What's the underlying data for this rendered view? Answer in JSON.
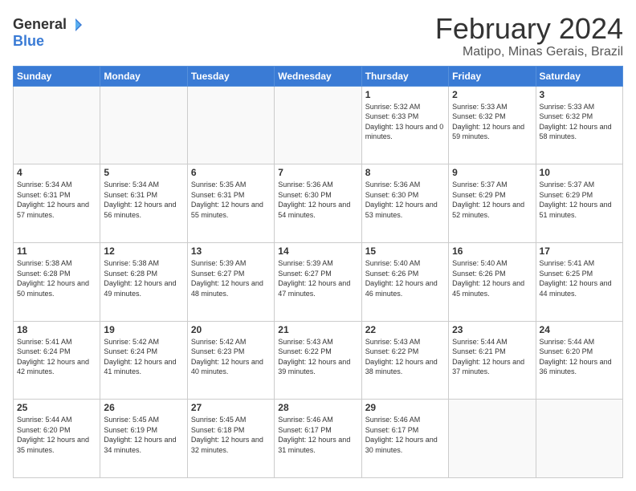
{
  "header": {
    "logo": {
      "general": "General",
      "blue": "Blue"
    },
    "title": "February 2024",
    "location": "Matipo, Minas Gerais, Brazil"
  },
  "weekdays": [
    "Sunday",
    "Monday",
    "Tuesday",
    "Wednesday",
    "Thursday",
    "Friday",
    "Saturday"
  ],
  "weeks": [
    [
      {
        "day": "",
        "sunrise": "",
        "sunset": "",
        "daylight": "",
        "empty": true
      },
      {
        "day": "",
        "sunrise": "",
        "sunset": "",
        "daylight": "",
        "empty": true
      },
      {
        "day": "",
        "sunrise": "",
        "sunset": "",
        "daylight": "",
        "empty": true
      },
      {
        "day": "",
        "sunrise": "",
        "sunset": "",
        "daylight": "",
        "empty": true
      },
      {
        "day": "1",
        "sunrise": "5:32 AM",
        "sunset": "6:33 PM",
        "daylight": "13 hours and 0 minutes."
      },
      {
        "day": "2",
        "sunrise": "5:33 AM",
        "sunset": "6:32 PM",
        "daylight": "12 hours and 59 minutes."
      },
      {
        "day": "3",
        "sunrise": "5:33 AM",
        "sunset": "6:32 PM",
        "daylight": "12 hours and 58 minutes."
      }
    ],
    [
      {
        "day": "4",
        "sunrise": "5:34 AM",
        "sunset": "6:31 PM",
        "daylight": "12 hours and 57 minutes."
      },
      {
        "day": "5",
        "sunrise": "5:34 AM",
        "sunset": "6:31 PM",
        "daylight": "12 hours and 56 minutes."
      },
      {
        "day": "6",
        "sunrise": "5:35 AM",
        "sunset": "6:31 PM",
        "daylight": "12 hours and 55 minutes."
      },
      {
        "day": "7",
        "sunrise": "5:36 AM",
        "sunset": "6:30 PM",
        "daylight": "12 hours and 54 minutes."
      },
      {
        "day": "8",
        "sunrise": "5:36 AM",
        "sunset": "6:30 PM",
        "daylight": "12 hours and 53 minutes."
      },
      {
        "day": "9",
        "sunrise": "5:37 AM",
        "sunset": "6:29 PM",
        "daylight": "12 hours and 52 minutes."
      },
      {
        "day": "10",
        "sunrise": "5:37 AM",
        "sunset": "6:29 PM",
        "daylight": "12 hours and 51 minutes."
      }
    ],
    [
      {
        "day": "11",
        "sunrise": "5:38 AM",
        "sunset": "6:28 PM",
        "daylight": "12 hours and 50 minutes."
      },
      {
        "day": "12",
        "sunrise": "5:38 AM",
        "sunset": "6:28 PM",
        "daylight": "12 hours and 49 minutes."
      },
      {
        "day": "13",
        "sunrise": "5:39 AM",
        "sunset": "6:27 PM",
        "daylight": "12 hours and 48 minutes."
      },
      {
        "day": "14",
        "sunrise": "5:39 AM",
        "sunset": "6:27 PM",
        "daylight": "12 hours and 47 minutes."
      },
      {
        "day": "15",
        "sunrise": "5:40 AM",
        "sunset": "6:26 PM",
        "daylight": "12 hours and 46 minutes."
      },
      {
        "day": "16",
        "sunrise": "5:40 AM",
        "sunset": "6:26 PM",
        "daylight": "12 hours and 45 minutes."
      },
      {
        "day": "17",
        "sunrise": "5:41 AM",
        "sunset": "6:25 PM",
        "daylight": "12 hours and 44 minutes."
      }
    ],
    [
      {
        "day": "18",
        "sunrise": "5:41 AM",
        "sunset": "6:24 PM",
        "daylight": "12 hours and 42 minutes."
      },
      {
        "day": "19",
        "sunrise": "5:42 AM",
        "sunset": "6:24 PM",
        "daylight": "12 hours and 41 minutes."
      },
      {
        "day": "20",
        "sunrise": "5:42 AM",
        "sunset": "6:23 PM",
        "daylight": "12 hours and 40 minutes."
      },
      {
        "day": "21",
        "sunrise": "5:43 AM",
        "sunset": "6:22 PM",
        "daylight": "12 hours and 39 minutes."
      },
      {
        "day": "22",
        "sunrise": "5:43 AM",
        "sunset": "6:22 PM",
        "daylight": "12 hours and 38 minutes."
      },
      {
        "day": "23",
        "sunrise": "5:44 AM",
        "sunset": "6:21 PM",
        "daylight": "12 hours and 37 minutes."
      },
      {
        "day": "24",
        "sunrise": "5:44 AM",
        "sunset": "6:20 PM",
        "daylight": "12 hours and 36 minutes."
      }
    ],
    [
      {
        "day": "25",
        "sunrise": "5:44 AM",
        "sunset": "6:20 PM",
        "daylight": "12 hours and 35 minutes."
      },
      {
        "day": "26",
        "sunrise": "5:45 AM",
        "sunset": "6:19 PM",
        "daylight": "12 hours and 34 minutes."
      },
      {
        "day": "27",
        "sunrise": "5:45 AM",
        "sunset": "6:18 PM",
        "daylight": "12 hours and 32 minutes."
      },
      {
        "day": "28",
        "sunrise": "5:46 AM",
        "sunset": "6:17 PM",
        "daylight": "12 hours and 31 minutes."
      },
      {
        "day": "29",
        "sunrise": "5:46 AM",
        "sunset": "6:17 PM",
        "daylight": "12 hours and 30 minutes."
      },
      {
        "day": "",
        "sunrise": "",
        "sunset": "",
        "daylight": "",
        "empty": true
      },
      {
        "day": "",
        "sunrise": "",
        "sunset": "",
        "daylight": "",
        "empty": true
      }
    ]
  ]
}
